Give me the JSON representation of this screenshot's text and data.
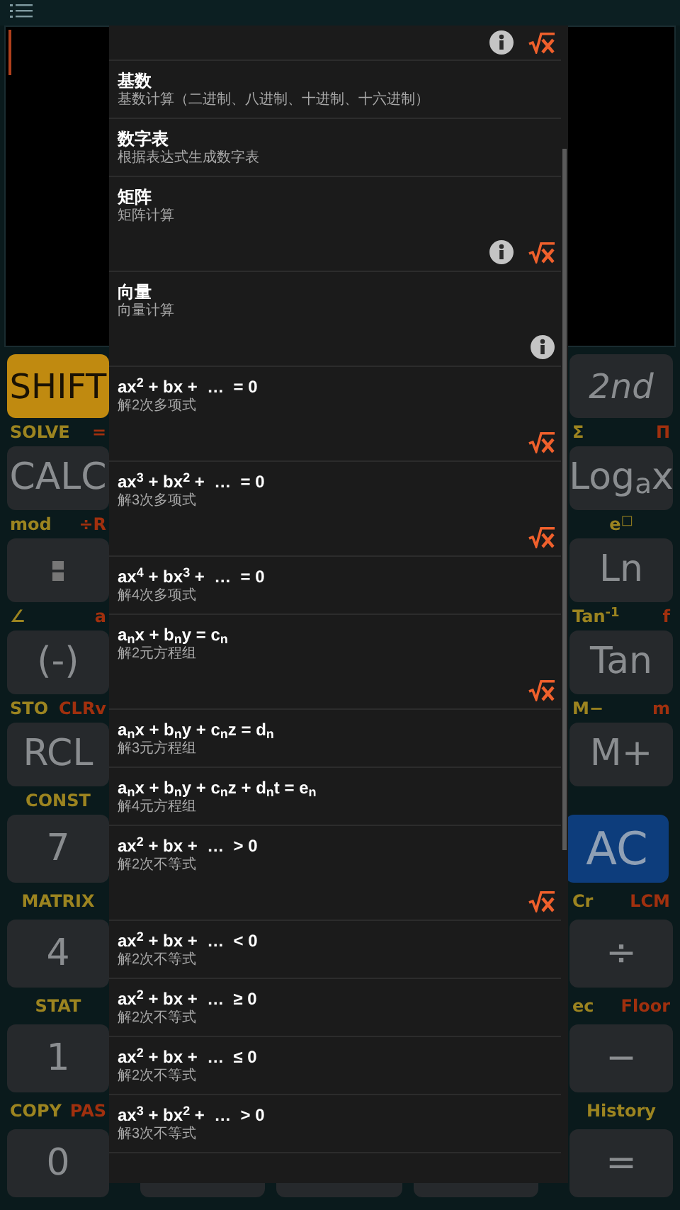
{
  "left_keys": [
    {
      "key": {
        "label": "SHIFT",
        "kind": "shift"
      },
      "labels": {
        "shift": "SOLVE",
        "alpha": "="
      }
    },
    {
      "key": {
        "label": "CALC",
        "kind": "plain"
      },
      "labels": {
        "shift": "mod",
        "alpha": "÷R"
      }
    },
    {
      "key": {
        "kind": "fraction"
      },
      "labels": {
        "shift": "∠",
        "alpha": "a"
      }
    },
    {
      "key": {
        "label": "(-)",
        "kind": "plain"
      },
      "labels": {
        "shift": "STO",
        "alpha": "CLRv"
      }
    },
    {
      "key": {
        "label": "RCL",
        "kind": "plain"
      },
      "labels": {
        "shift": "CONST"
      }
    },
    {
      "key": {
        "label": "7",
        "kind": "plain"
      },
      "labels": {
        "shift": "MATRIX"
      }
    },
    {
      "key": {
        "label": "4",
        "kind": "plain"
      },
      "labels": {
        "shift": "STAT"
      }
    },
    {
      "key": {
        "label": "1",
        "kind": "plain"
      },
      "labels": {
        "shift": "COPY",
        "alpha": "PAS"
      }
    },
    {
      "key": {
        "label": "0",
        "kind": "plain"
      }
    }
  ],
  "right_keys": [
    {
      "key": {
        "label": "2nd",
        "kind": "mode"
      },
      "labels": {
        "shift": "Σ",
        "alpha": "Π"
      }
    },
    {
      "key": {
        "label": "Log$_{a}$x",
        "kind": "plain"
      },
      "labels": {
        "shift": "e$^{□}$"
      }
    },
    {
      "key": {
        "label": "Ln",
        "kind": "plain"
      },
      "labels": {
        "shift": "Tan$^{-1}$",
        "alpha": "f"
      }
    },
    {
      "key": {
        "label": "Tan",
        "kind": "plain"
      },
      "labels": {
        "shift": "M−",
        "alpha": "m"
      }
    },
    {
      "key": {
        "label": "M+",
        "kind": "plain"
      }
    },
    {
      "key": {
        "label": "AC",
        "kind": "clear"
      },
      "labels": {
        "shift": "Cr",
        "alpha": "LCM"
      }
    },
    {
      "key": {
        "label": "÷",
        "kind": "plain"
      },
      "labels": {
        "shift": "ec",
        "alpha": "Floor"
      }
    },
    {
      "key": {
        "label": "−",
        "kind": "plain"
      },
      "labels": {
        "shift": "History"
      }
    },
    {
      "key": {
        "label": "=",
        "kind": "plain"
      }
    }
  ],
  "menu": {
    "items": [
      {
        "info_button": true,
        "root_button": true
      },
      {
        "title": "基数",
        "subtitle": "基数计算（二进制、八进制、十进制、十六进制）",
        "info_button": false,
        "root_button": false
      },
      {
        "title": "数字表",
        "subtitle": "根据表达式生成数字表",
        "info_button": false,
        "root_button": false
      },
      {
        "title": "矩阵",
        "subtitle": "矩阵计算",
        "info_button": true,
        "root_button": true
      },
      {
        "title": "向量",
        "subtitle": "向量计算",
        "info_button": true,
        "root_button": false
      },
      {
        "title": "ax$^{2}$ + bx +  …  = 0",
        "subtitle": "解2次多项式",
        "info_button": false,
        "root_button": true
      },
      {
        "title": "ax$^{3}$ + bx$^{2}$ +  …  = 0",
        "subtitle": "解3次多项式",
        "info_button": false,
        "root_button": true
      },
      {
        "title": "ax$^{4}$ + bx$^{3}$ +  …  = 0",
        "subtitle": "解4次多项式",
        "info_button": false,
        "root_button": false
      },
      {
        "title": "a$_{n}$x + b$_{n}$y = c$_{n}$",
        "subtitle": "解2元方程组",
        "info_button": false,
        "root_button": true
      },
      {
        "title": "a$_{n}$x + b$_{n}$y + c$_{n}$z = d$_{n}$",
        "subtitle": "解3元方程组",
        "info_button": false,
        "root_button": false
      },
      {
        "title": "a$_{n}$x + b$_{n}$y + c$_{n}$z + d$_{n}$t = e$_{n}$",
        "subtitle": "解4元方程组",
        "info_button": false,
        "root_button": false
      },
      {
        "title": "ax$^{2}$ + bx +  …  > 0",
        "subtitle": "解2次不等式",
        "info_button": false,
        "root_button": true
      },
      {
        "title": "ax$^{2}$ + bx +  …  < 0",
        "subtitle": "解2次不等式",
        "info_button": false,
        "root_button": false
      },
      {
        "title": "ax$^{2}$ + bx +  …  ≥ 0",
        "subtitle": "解2次不等式",
        "info_button": false,
        "root_button": false
      },
      {
        "title": "ax$^{2}$ + bx +  …  ≤ 0",
        "subtitle": "解2次不等式",
        "info_button": false,
        "root_button": false
      },
      {
        "title": "ax$^{3}$ + bx$^{2}$ +  …  > 0",
        "subtitle": "解3次不等式",
        "info_button": false,
        "root_button": false
      }
    ]
  }
}
